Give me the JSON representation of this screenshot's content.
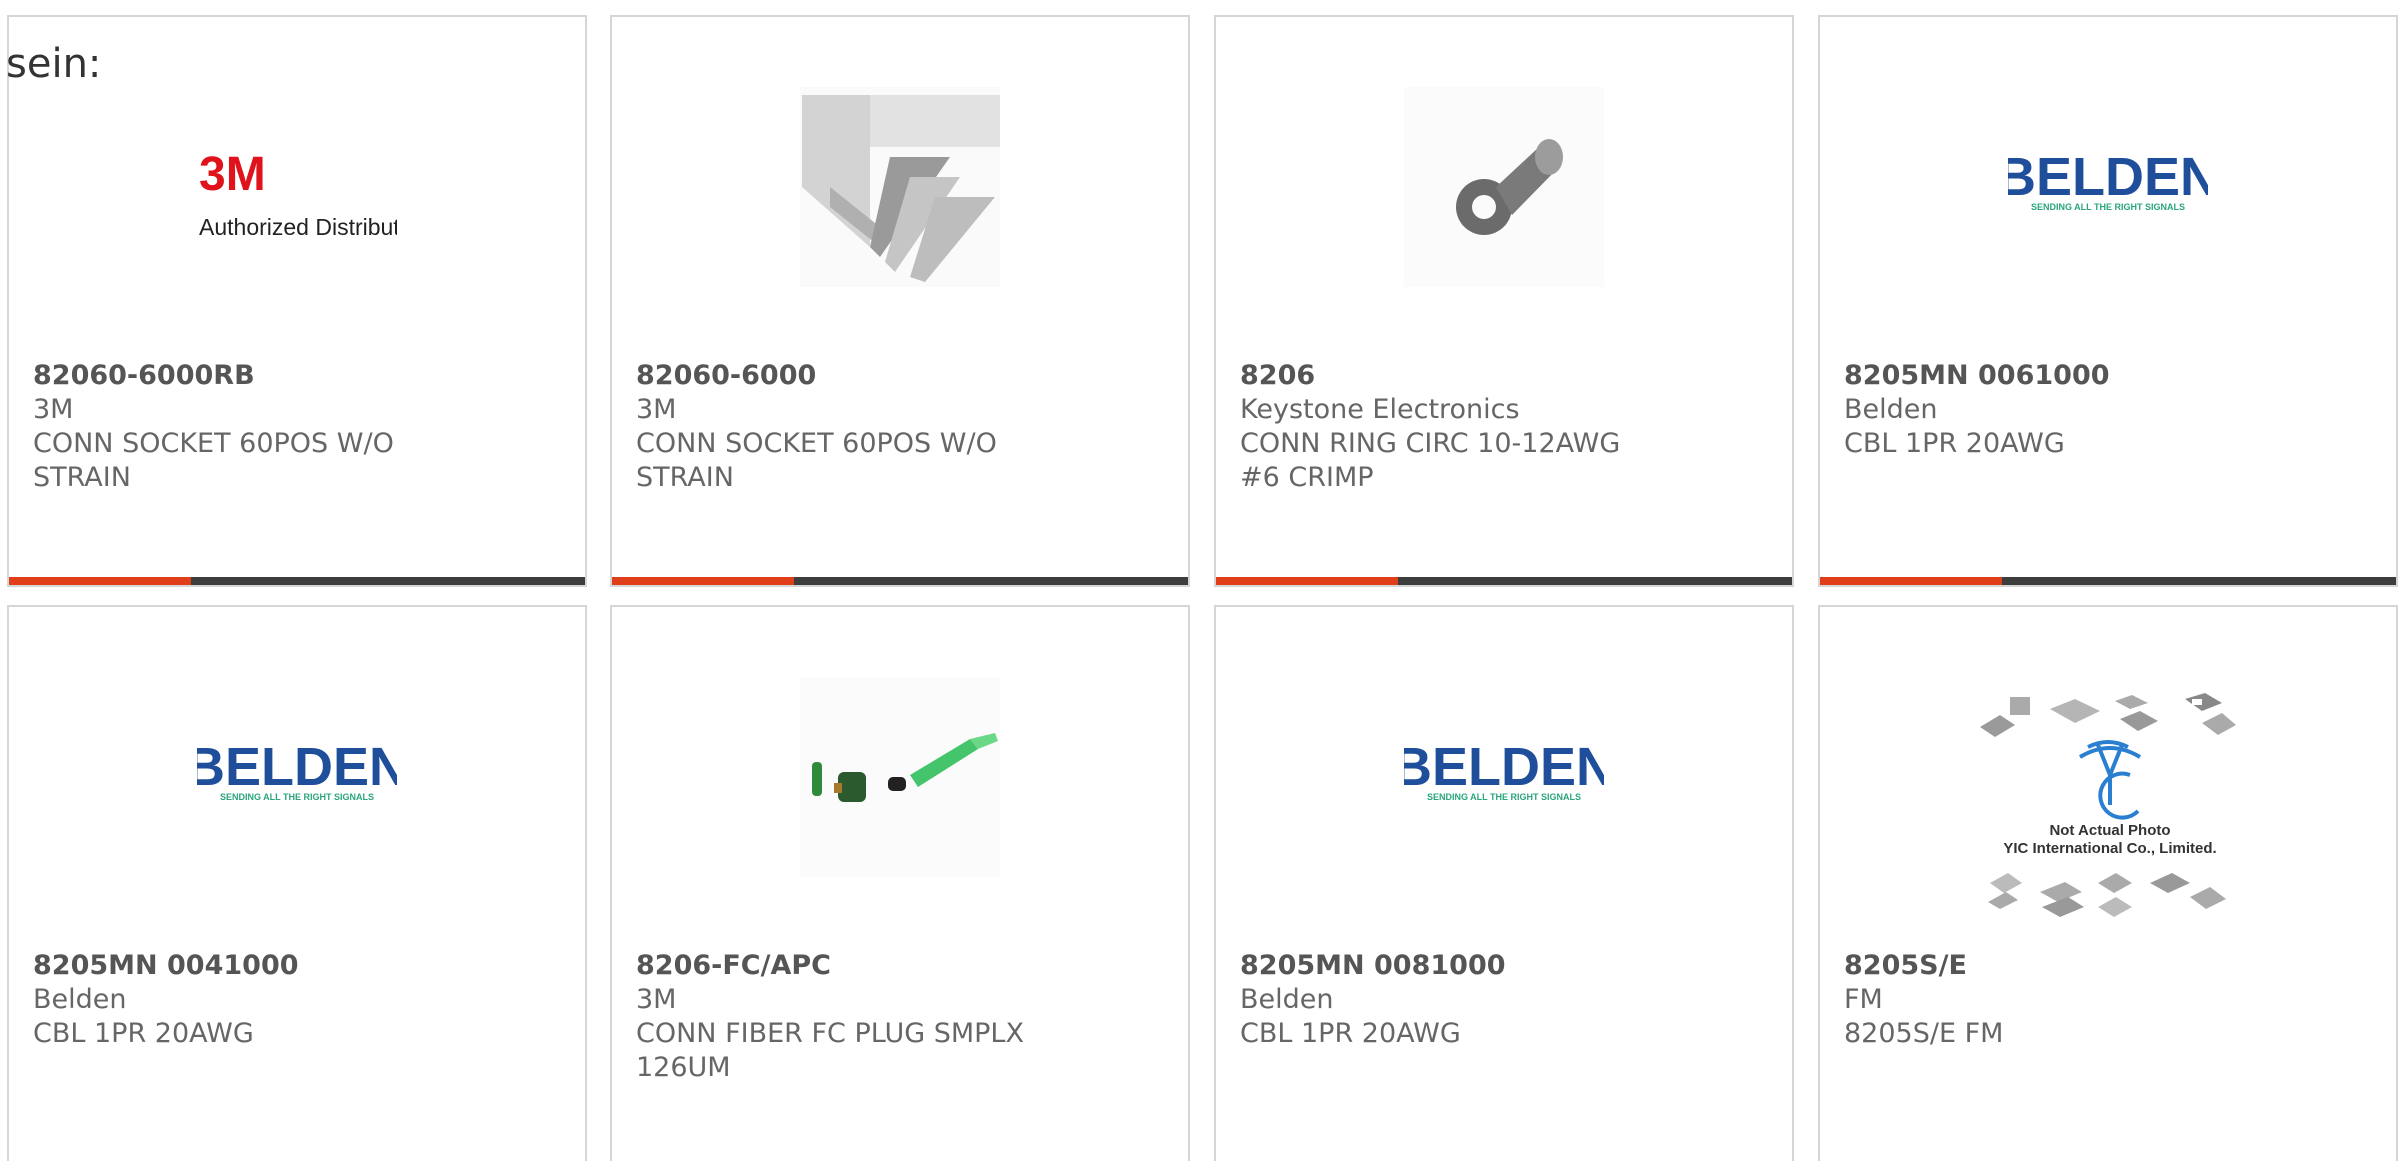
{
  "intro_text": "sein:",
  "colors": {
    "accent_bar": "#e03e1a",
    "dark_bar": "#3d3d3d",
    "belden_blue": "#1f4e9b",
    "belden_green": "#2aa57d",
    "threeM_red": "#e0121b",
    "yic_blue": "#2a7fd0"
  },
  "products": [
    {
      "part_number": "82060-6000RB",
      "manufacturer": "3M",
      "description": "CONN SOCKET 60POS W/O STRAIN",
      "image_icon": "3m-logo-icon",
      "logo_text": "3M",
      "logo_sub": "Authorized Distributor"
    },
    {
      "part_number": "82060-6000",
      "manufacturer": "3M",
      "description": "CONN SOCKET 60POS W/O STRAIN",
      "image_icon": "ribbon-cable-connector-icon"
    },
    {
      "part_number": "8206",
      "manufacturer": "Keystone Electronics",
      "description": "CONN RING CIRC 10-12AWG #6 CRIMP",
      "image_icon": "ring-terminal-icon"
    },
    {
      "part_number": "8205MN 0061000",
      "manufacturer": "Belden",
      "description": "CBL 1PR 20AWG",
      "image_icon": "belden-logo-icon",
      "logo_text": "BELDEN",
      "logo_sub": "SENDING ALL THE RIGHT SIGNALS"
    },
    {
      "part_number": "8205MN 0041000",
      "manufacturer": "Belden",
      "description": "CBL 1PR 20AWG",
      "image_icon": "belden-logo-icon",
      "logo_text": "BELDEN",
      "logo_sub": "SENDING ALL THE RIGHT SIGNALS"
    },
    {
      "part_number": "8206-FC/APC",
      "manufacturer": "3M",
      "description": "CONN FIBER FC PLUG SMPLX 126UM",
      "image_icon": "fiber-connector-icon"
    },
    {
      "part_number": "8205MN 0081000",
      "manufacturer": "Belden",
      "description": "CBL 1PR 20AWG",
      "image_icon": "belden-logo-icon",
      "logo_text": "BELDEN",
      "logo_sub": "SENDING ALL THE RIGHT SIGNALS"
    },
    {
      "part_number": "8205S/E",
      "manufacturer": "FM",
      "description": "8205S/E FM",
      "image_icon": "yic-placeholder-icon",
      "logo_text": "YIC",
      "logo_sub": "Not Actual Photo",
      "logo_sub2": "YIC International Co., Limited."
    }
  ]
}
